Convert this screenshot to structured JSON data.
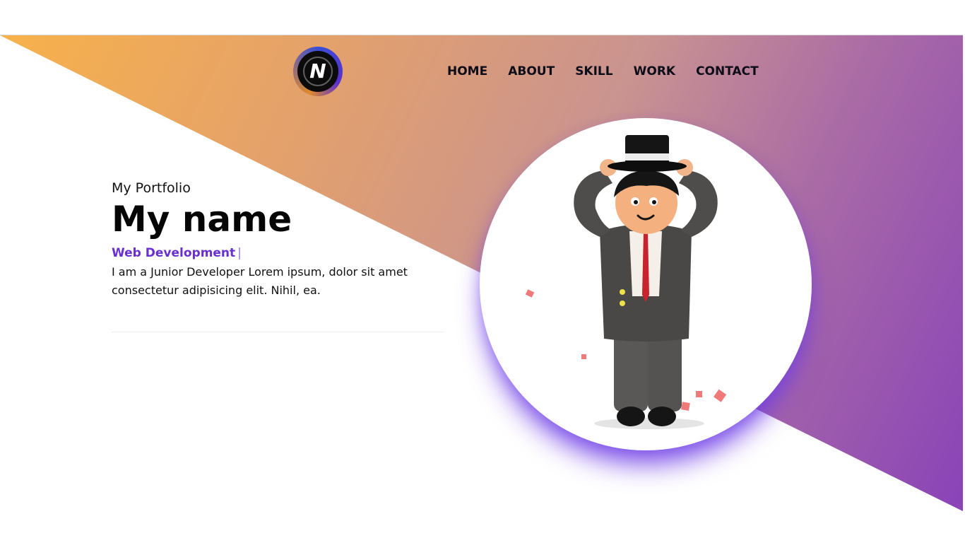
{
  "nav": {
    "items": [
      {
        "label": "HOME"
      },
      {
        "label": "ABOUT"
      },
      {
        "label": "SKILL"
      },
      {
        "label": "WORK"
      },
      {
        "label": "CONTACT"
      }
    ]
  },
  "hero": {
    "eyebrow": "My Portfolio",
    "name": "My name",
    "role": "Web Development",
    "role_caret": "|",
    "description": "I am a Junior Developer Lorem ipsum, dolor sit amet consectetur adipisicing elit. Nihil, ea."
  },
  "logo": {
    "letter": "N"
  },
  "colors": {
    "gradient_start": "#f8b14a",
    "gradient_end": "#8a43b8",
    "accent": "#6a2fd0",
    "text": "#0d0d1a"
  },
  "icons": {
    "logo": "n-logo-icon",
    "portrait": "character-illustration"
  }
}
